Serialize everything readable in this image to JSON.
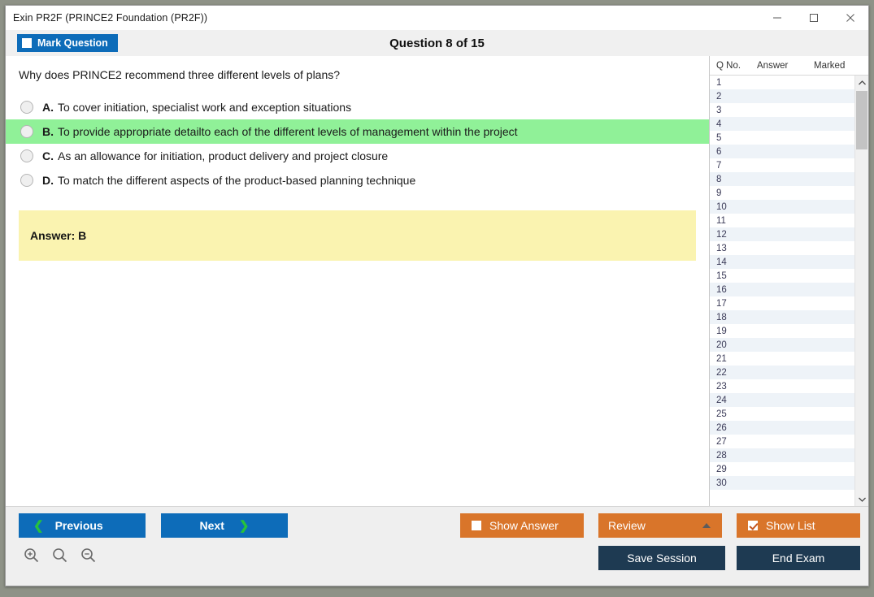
{
  "window": {
    "title": "Exin PR2F (PRINCE2 Foundation (PR2F))",
    "controls": {
      "minimize": "minimize-icon",
      "maximize": "maximize-icon",
      "close": "close-icon"
    }
  },
  "header": {
    "mark_question_label": "Mark Question",
    "mark_question_checked": false,
    "question_counter": "Question 8 of 15"
  },
  "question": {
    "text": "Why does PRINCE2 recommend three different levels of plans?",
    "options": [
      {
        "letter": "A.",
        "text": "To cover initiation, specialist work and exception situations",
        "highlighted": false,
        "selected": false
      },
      {
        "letter": "B.",
        "text": "To provide appropriate detailto each of the different levels of management within the project",
        "highlighted": true,
        "selected": false
      },
      {
        "letter": "C.",
        "text": "As an allowance for initiation, product delivery and project closure",
        "highlighted": false,
        "selected": false
      },
      {
        "letter": "D.",
        "text": "To match the different aspects of the product-based planning technique",
        "highlighted": false,
        "selected": false
      }
    ],
    "answer_label": "Answer: B"
  },
  "list_panel": {
    "columns": [
      "Q No.",
      "Answer",
      "Marked"
    ],
    "rows": [
      {
        "no": "1",
        "answer": "",
        "marked": ""
      },
      {
        "no": "2",
        "answer": "",
        "marked": ""
      },
      {
        "no": "3",
        "answer": "",
        "marked": ""
      },
      {
        "no": "4",
        "answer": "",
        "marked": ""
      },
      {
        "no": "5",
        "answer": "",
        "marked": ""
      },
      {
        "no": "6",
        "answer": "",
        "marked": ""
      },
      {
        "no": "7",
        "answer": "",
        "marked": ""
      },
      {
        "no": "8",
        "answer": "",
        "marked": ""
      },
      {
        "no": "9",
        "answer": "",
        "marked": ""
      },
      {
        "no": "10",
        "answer": "",
        "marked": ""
      },
      {
        "no": "11",
        "answer": "",
        "marked": ""
      },
      {
        "no": "12",
        "answer": "",
        "marked": ""
      },
      {
        "no": "13",
        "answer": "",
        "marked": ""
      },
      {
        "no": "14",
        "answer": "",
        "marked": ""
      },
      {
        "no": "15",
        "answer": "",
        "marked": ""
      },
      {
        "no": "16",
        "answer": "",
        "marked": ""
      },
      {
        "no": "17",
        "answer": "",
        "marked": ""
      },
      {
        "no": "18",
        "answer": "",
        "marked": ""
      },
      {
        "no": "19",
        "answer": "",
        "marked": ""
      },
      {
        "no": "20",
        "answer": "",
        "marked": ""
      },
      {
        "no": "21",
        "answer": "",
        "marked": ""
      },
      {
        "no": "22",
        "answer": "",
        "marked": ""
      },
      {
        "no": "23",
        "answer": "",
        "marked": ""
      },
      {
        "no": "24",
        "answer": "",
        "marked": ""
      },
      {
        "no": "25",
        "answer": "",
        "marked": ""
      },
      {
        "no": "26",
        "answer": "",
        "marked": ""
      },
      {
        "no": "27",
        "answer": "",
        "marked": ""
      },
      {
        "no": "28",
        "answer": "",
        "marked": ""
      },
      {
        "no": "29",
        "answer": "",
        "marked": ""
      },
      {
        "no": "30",
        "answer": "",
        "marked": ""
      }
    ]
  },
  "footer": {
    "previous_label": "Previous",
    "next_label": "Next",
    "show_answer_label": "Show Answer",
    "show_answer_checked": false,
    "review_label": "Review",
    "show_list_label": "Show List",
    "show_list_checked": true,
    "save_session_label": "Save Session",
    "end_exam_label": "End Exam",
    "zoom_icons": [
      "zoom-in-icon",
      "zoom-reset-icon",
      "zoom-out-icon"
    ]
  },
  "colors": {
    "accent_blue": "#0d6cb9",
    "accent_orange": "#d9752a",
    "accent_navy": "#1e3a52",
    "highlight_green": "#90f198",
    "answer_yellow": "#faf3b0",
    "chevron_green": "#27c23c"
  }
}
